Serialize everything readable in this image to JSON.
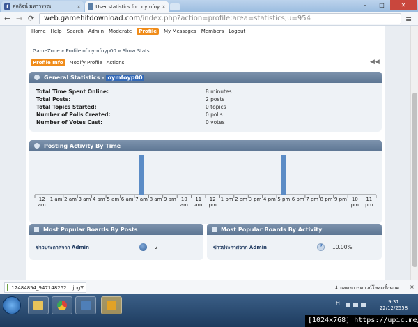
{
  "browser": {
    "tabs": [
      {
        "label": "ศุลกิจน์ มหาวรรณ",
        "close": "×"
      },
      {
        "label": "User statistics for: oymfoy",
        "close": "×"
      }
    ],
    "window_controls": {
      "minimize": "–",
      "maximize": "□",
      "close": "✕"
    },
    "address": {
      "domain": "web.gamehitdownload.com",
      "path": "/index.php?action=profile;area=statistics;u=954"
    }
  },
  "forum": {
    "menu": [
      "Home",
      "Help",
      "Search",
      "Admin",
      "Moderate",
      "Profile",
      "My Messages",
      "Members",
      "Logout"
    ],
    "menu_active": "Profile",
    "breadcrumb": "GameZone » Profile of oymfoyp00 » Show Stats",
    "subtabs": [
      "Profile Info",
      "Modify Profile",
      "Actions"
    ],
    "subtab_active": "Profile Info",
    "general": {
      "title_prefix": "General Statistics - ",
      "username": "oymfoyp00",
      "rows": [
        {
          "label": "Total Time Spent Online:",
          "value": "8 minutes."
        },
        {
          "label": "Total Posts:",
          "value": "2 posts"
        },
        {
          "label": "Total Topics Started:",
          "value": "0 topics"
        },
        {
          "label": "Number of Polls Created:",
          "value": "0 polls"
        },
        {
          "label": "Number of Votes Cast:",
          "value": "0 votes"
        }
      ]
    },
    "activity_title": "Posting Activity By Time",
    "popular_posts": {
      "title": "Most Popular Boards By Posts",
      "board": "ข่าวประกาศจาก Admin",
      "value": "2"
    },
    "popular_activity": {
      "title": "Most Popular Boards By Activity",
      "board": "ข่าวประกาศจาก Admin",
      "value": "10.00%"
    }
  },
  "chart_data": {
    "type": "bar",
    "title": "Posting Activity By Time",
    "categories": [
      [
        "12",
        "am"
      ],
      [
        "1 am"
      ],
      [
        "2 am"
      ],
      [
        "3 am"
      ],
      [
        "4 am"
      ],
      [
        "5 am"
      ],
      [
        "6 am"
      ],
      [
        "7 am"
      ],
      [
        "8 am"
      ],
      [
        "9 am"
      ],
      [
        "10",
        "am"
      ],
      [
        "11",
        "am"
      ],
      [
        "12",
        "pm"
      ],
      [
        "1 pm"
      ],
      [
        "2 pm"
      ],
      [
        "3 pm"
      ],
      [
        "4 pm"
      ],
      [
        "5 pm"
      ],
      [
        "6 pm"
      ],
      [
        "7 pm"
      ],
      [
        "8 pm"
      ],
      [
        "9 pm"
      ],
      [
        "10",
        "pm"
      ],
      [
        "11",
        "pm"
      ]
    ],
    "values": [
      0,
      0,
      0,
      0,
      0,
      0,
      0,
      1,
      0,
      0,
      0,
      0,
      0,
      0,
      0,
      0,
      0,
      1,
      0,
      0,
      0,
      0,
      0,
      0
    ],
    "ylim": [
      0,
      1
    ],
    "bar_color": "#5b8cc6"
  },
  "downloads": {
    "file": "12484854_947148252....jpg",
    "show_all": "แสดงการดาวน์โหลดทั้งหมด...",
    "close": "×"
  },
  "taskbar": {
    "lang": "TH",
    "time": "9:31",
    "date": "22/12/2558"
  },
  "watermark": "[1024x768] https://upic.me/",
  "colors": {
    "accent": "#f08c1a",
    "header": "#5d7693",
    "panel": "#eef2f6"
  }
}
